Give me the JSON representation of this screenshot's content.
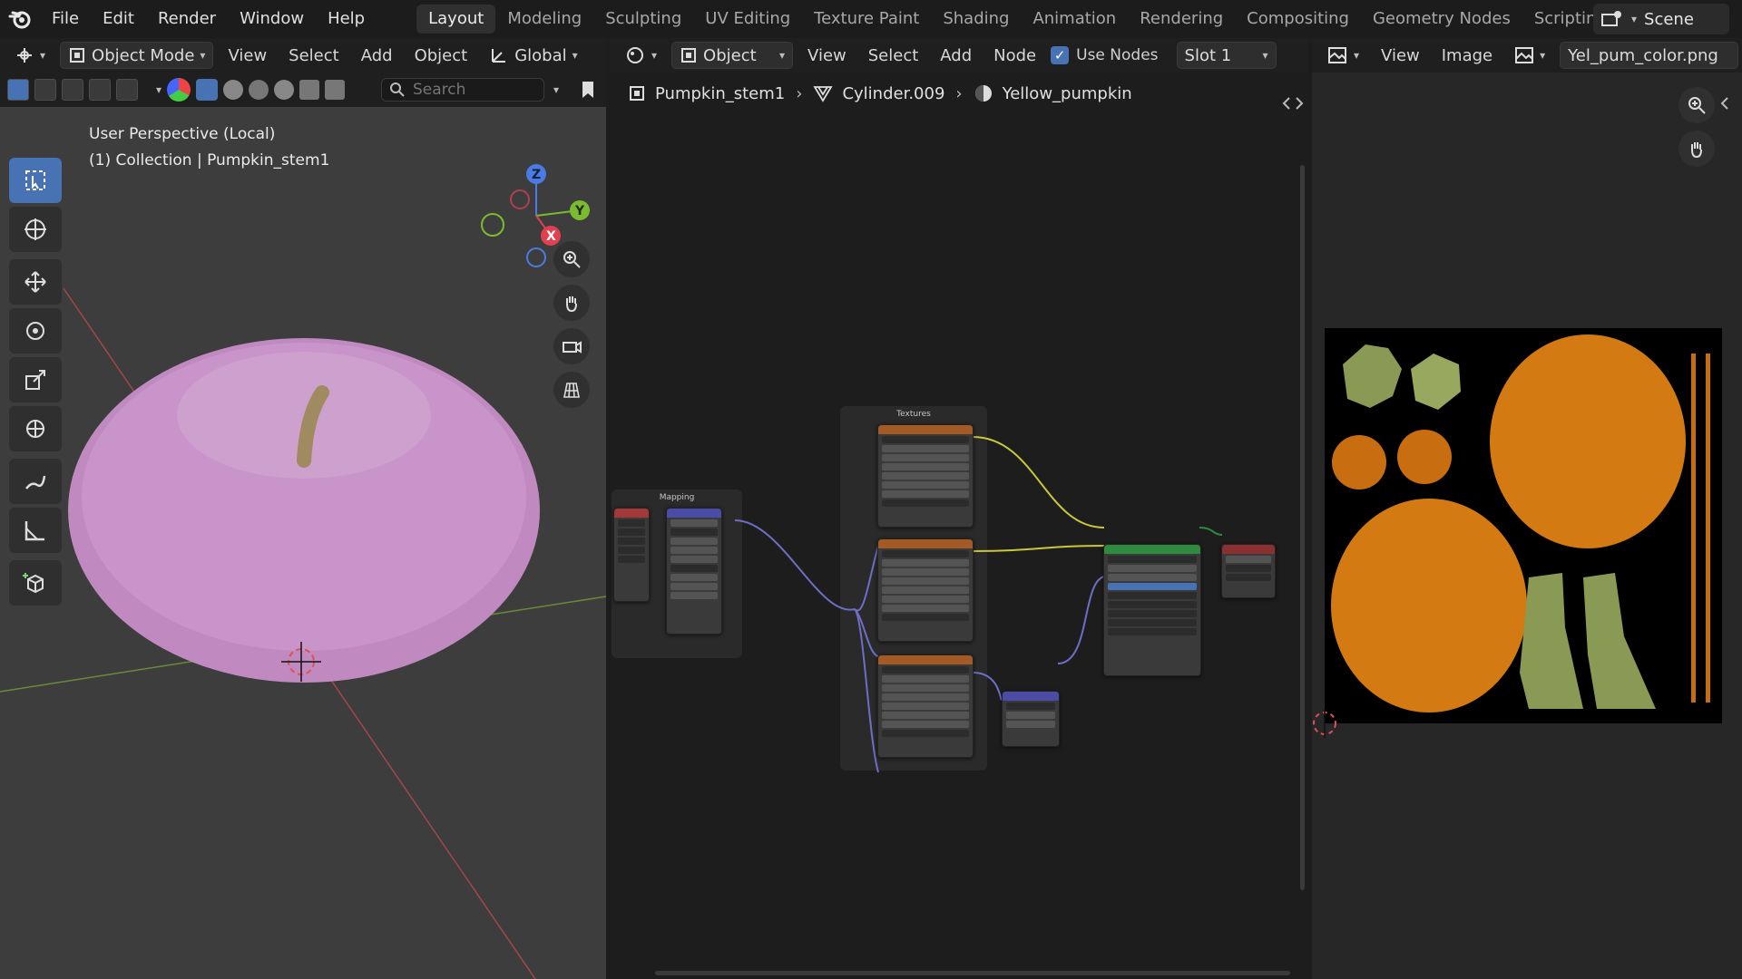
{
  "menu": [
    "File",
    "Edit",
    "Render",
    "Window",
    "Help"
  ],
  "workspaces": [
    "Layout",
    "Modeling",
    "Sculpting",
    "UV Editing",
    "Texture Paint",
    "Shading",
    "Animation",
    "Rendering",
    "Compositing",
    "Geometry Nodes",
    "Scripting"
  ],
  "active_workspace": "Layout",
  "scene": "Scene",
  "viewport": {
    "mode": "Object Mode",
    "menus": [
      "View",
      "Select",
      "Add",
      "Object"
    ],
    "orientation": "Global",
    "search_placeholder": "Search",
    "perspective": "User Perspective (Local)",
    "collection": "(1) Collection | Pumpkin_stem1",
    "gizmo_axes": [
      "Z",
      "Y",
      "X"
    ],
    "colors": {
      "pumpkin": "#c28bc2",
      "stem": "#a08a60",
      "bg": "#3d3d3d"
    }
  },
  "node_editor": {
    "type": "Object",
    "menus": [
      "View",
      "Select",
      "Add",
      "Node"
    ],
    "use_nodes_label": "Use Nodes",
    "use_nodes_checked": true,
    "slot": "Slot 1",
    "breadcrumb": [
      "Pumpkin_stem1",
      "Cylinder.009",
      "Yellow_pumpkin"
    ],
    "frames": [
      "Mapping",
      "Textures"
    ],
    "colors": {
      "texture_head": "#a35a24",
      "bsdf_head": "#2e8a3c",
      "vector_head": "#4b4ba8",
      "link_yellow": "#c8c83a",
      "link_purple": "#6e6ec8"
    }
  },
  "image_editor": {
    "menus": [
      "View",
      "Image"
    ],
    "image_name": "Yel_pum_color.png",
    "colors": {
      "pumpkin_orange": "#d37a12",
      "leaf_green": "#8a9a55"
    }
  }
}
